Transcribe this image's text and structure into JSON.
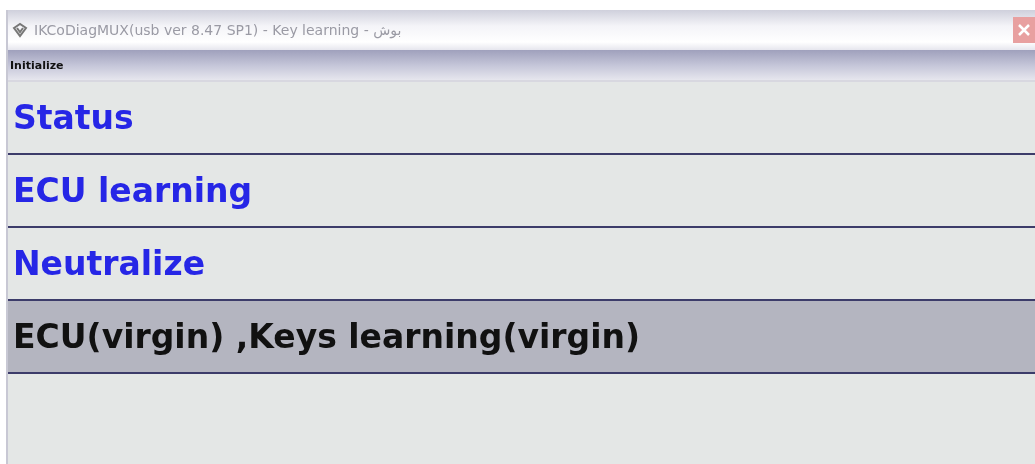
{
  "window": {
    "title": "IKCoDiagMUX(usb ver 8.47 SP1)  - Key learning - بوش"
  },
  "toolbar": {
    "label": "Initialize"
  },
  "menu_items": [
    {
      "label": "Status",
      "selected": false
    },
    {
      "label": "ECU learning",
      "selected": false
    },
    {
      "label": "Neutralize",
      "selected": false
    },
    {
      "label": "ECU(virgin) ,Keys learning(virgin)",
      "selected": true
    }
  ]
}
